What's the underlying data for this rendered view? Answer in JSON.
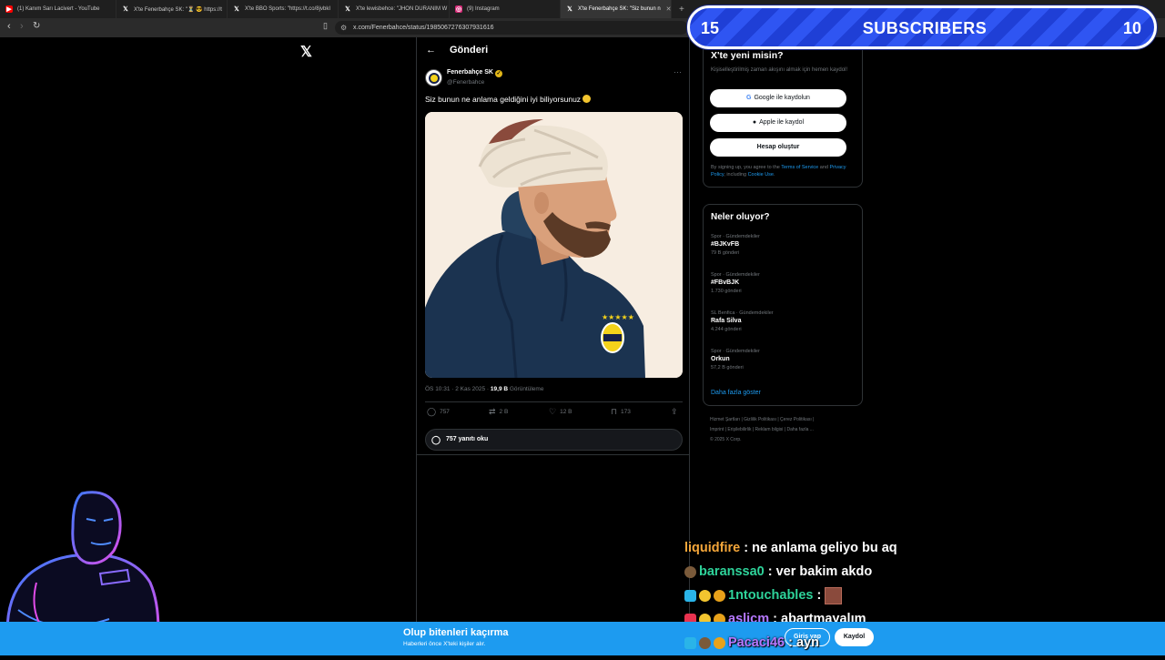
{
  "browser": {
    "tabs": [
      {
        "label": "(1) Kanım Sarı Lacivert - YouTube",
        "favicon": "youtube-icon",
        "color": "#ff0000"
      },
      {
        "label": "X'te Fenerbahçe SK: \"⏳ 😎 https://t",
        "favicon": "x-icon",
        "color": "#000000"
      },
      {
        "label": "X'te BBO Sports: \"https://t.co/8jvbkI",
        "favicon": "x-icon",
        "color": "#000000"
      },
      {
        "label": "X'te lewisbehce: \"JHON DURANIM W",
        "favicon": "x-icon",
        "color": "#000000"
      },
      {
        "label": "(9) Instagram",
        "favicon": "instagram-icon",
        "color": "#d62976"
      },
      {
        "label": "X'te Fenerbahçe SK: \"Siz bunun n",
        "favicon": "x-icon",
        "color": "#000000",
        "active": true
      }
    ],
    "new_tab": "+",
    "url": "x.com/Fenerbahce/status/1985067276307931616"
  },
  "post_page": {
    "header_title": "Gönderi",
    "account_name": "Fenerbahçe SK",
    "account_handle": "@Fenerbahce",
    "text": "Siz bunun ne anlama geldiğini iyi biliyorsunuz",
    "timestamp": "ÖS 10:31 · 2 Kas 2025 · ",
    "views_count": "19,9 B",
    "views_label": " Görüntüleme",
    "stats": {
      "replies": "757",
      "reposts": "2 B",
      "likes": "12 B",
      "bookmarks": "173"
    },
    "read_replies": "757 yanıtı oku"
  },
  "signup": {
    "title": "X'te yeni misin?",
    "description": "Kişiselleştirilmiş zaman akışını almak için hemen kaydol!",
    "google_button": "Google ile kaydolun",
    "apple_button": "Apple ile kaydol",
    "create_button": "Hesap oluştur",
    "legal_prefix": "By signing up, you agree to the ",
    "terms": "Terms of Service",
    "legal_and": " and ",
    "privacy": "Privacy Policy",
    "legal_including": ", including ",
    "cookie": "Cookie Use",
    "legal_end": "."
  },
  "trends": {
    "title": "Neler oluyor?",
    "items": [
      {
        "context": "Spor · Gündemdekiler",
        "name": "#BJKvFB",
        "count": "79 B gönderi"
      },
      {
        "context": "Spor · Gündemdekiler",
        "name": "#FBvBJK",
        "count": "1.730 gönderi"
      },
      {
        "context": "SL Benfica · Gündemdekiler",
        "name": "Rafa Silva",
        "count": "4.244 gönderi"
      },
      {
        "context": "Spor · Gündemdekiler",
        "name": "Orkun",
        "count": "57,2 B gönderi"
      }
    ],
    "show_more": "Daha fazla göster"
  },
  "footer": {
    "line1": "Hizmet Şartları  |  Gizlilik Politikası  |  Çerez Politikası  |",
    "line2": "Imprint  |  Erişilebilirlik  |  Reklam bilgisi  |  Daha fazla ...",
    "line3": "© 2025 X Corp."
  },
  "subscriber_banner": {
    "left_count": "15",
    "label": "SUBSCRIBERS",
    "right_count": "10"
  },
  "chat": [
    {
      "user": "liquidfire",
      "color": "#f4a63a",
      "text": ": ne anlama geliyo bu aq",
      "badges": []
    },
    {
      "user": "baranssa0",
      "color": "#2ed39a",
      "text": ": ver bakim akdo",
      "badges": [
        "#7a5a3a"
      ]
    },
    {
      "user": "1ntouchables",
      "color": "#2ed39a",
      "text": ": ",
      "badges": [
        "#2ab4e8",
        "#f3c52f",
        "#e8a21a"
      ],
      "thumb": true
    },
    {
      "user": "aslicm",
      "color": "#b678ff",
      "text": ": abartmayalım",
      "badges": [
        "#e8324f",
        "#f3c52f",
        "#e8a21a"
      ]
    },
    {
      "user": "Pacaci46",
      "color": "#b678ff",
      "text": ": ayn",
      "badges": [
        "#2ab4e8",
        "#7a5a3a",
        "#e8a21a"
      ]
    }
  ],
  "bottom_bar": {
    "title": "Olup bitenleri kaçırma",
    "subtitle": "Haberleri önce X'teki kişiler alır.",
    "login": "Giriş yap",
    "signup": "Kaydol"
  }
}
